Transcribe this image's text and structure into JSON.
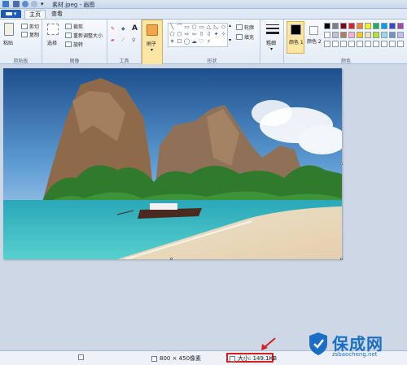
{
  "window": {
    "title": "素材.jpeg - 画图"
  },
  "menu": {
    "button_label": "▾"
  },
  "tabs": [
    {
      "label": "主页",
      "active": true
    },
    {
      "label": "查看",
      "active": false
    }
  ],
  "ribbon": {
    "clipboard": {
      "paste_label": "粘贴",
      "cut_label": "剪切",
      "copy_label": "复制",
      "group_label": "剪贴板"
    },
    "image": {
      "select_label": "选择",
      "crop_label": "裁剪",
      "resize_label": "重新调整大小",
      "rotate_label": "旋转",
      "group_label": "图像"
    },
    "tools": {
      "group_label": "工具",
      "text_tool": "A"
    },
    "brushes": {
      "label": "刷子"
    },
    "shapes": {
      "outline_label": "轮廓",
      "fill_label": "填充",
      "group_label": "形状",
      "glyphs": [
        "╲",
        "⌒",
        "▭",
        "○",
        "▭",
        "△",
        "◺",
        "◇",
        "⬠",
        "⬡",
        "⇨",
        "⇦",
        "⇧",
        "⇩",
        "✦",
        "✧",
        "✶",
        "☐",
        "◯",
        "☁",
        "♡",
        "⚡"
      ]
    },
    "size": {
      "label": "粗细"
    },
    "colors": {
      "color1_label": "颜色 1",
      "color2_label": "颜色 2",
      "group_label": "颜色",
      "color1": "#000000",
      "color2": "#ffffff",
      "palette_row1": [
        "#000000",
        "#7f7f7f",
        "#880015",
        "#ed1c24",
        "#ff7f27",
        "#fff200",
        "#22b14c",
        "#00a2e8",
        "#3f48cc",
        "#a349a4"
      ],
      "palette_row2": [
        "#ffffff",
        "#c3c3c3",
        "#b97a57",
        "#ffaec9",
        "#ffc90e",
        "#efe4b0",
        "#b5e61d",
        "#99d9ea",
        "#7092be",
        "#c8bfe7"
      ]
    }
  },
  "status": {
    "dimensions": "800 × 450像素",
    "file_size": "大小: 149.1KB"
  },
  "watermark": {
    "title": "保成网",
    "url": "zsbaocheng.net"
  }
}
